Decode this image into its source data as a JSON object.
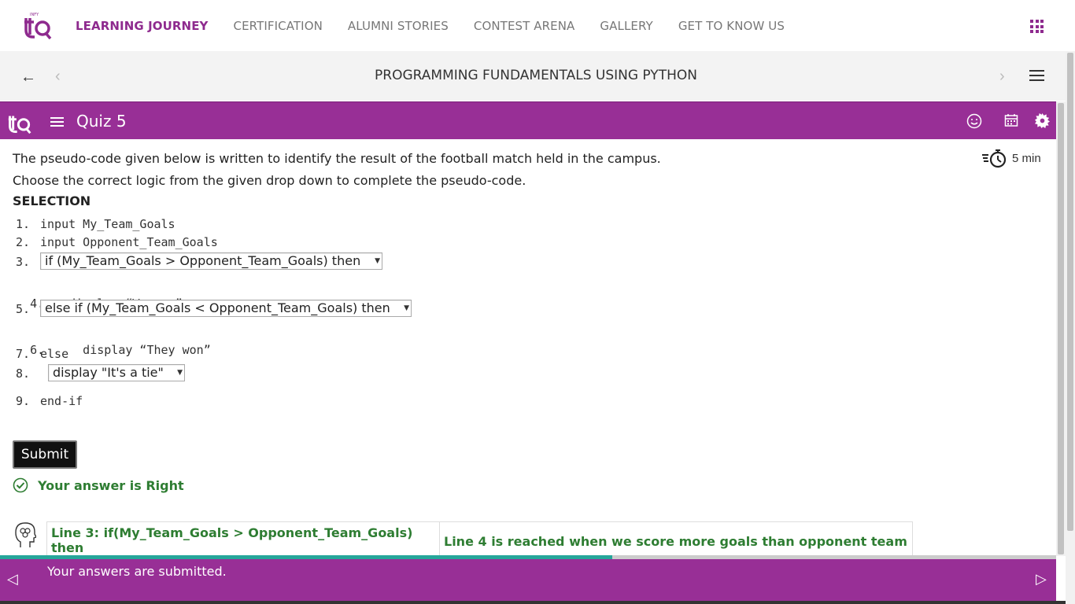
{
  "nav": {
    "items": [
      {
        "label": "LEARNING JOURNEY",
        "active": true
      },
      {
        "label": "CERTIFICATION",
        "active": false
      },
      {
        "label": "ALUMNI STORIES",
        "active": false
      },
      {
        "label": "CONTEST ARENA",
        "active": false
      },
      {
        "label": "GALLERY",
        "active": false
      },
      {
        "label": "GET TO KNOW US",
        "active": false
      }
    ],
    "apps_icon": "grid-apps-icon",
    "accent_color": "#8e2a8e"
  },
  "course": {
    "title": "PROGRAMMING FUNDAMENTALS USING PYTHON",
    "back_icon": "arrow-left-icon",
    "prev_icon": "chevron-left-icon",
    "next_icon": "chevron-right-icon",
    "menu_icon": "hamburger-icon"
  },
  "quiz": {
    "title": "Quiz 5",
    "header_color": "#982f96",
    "icons": [
      "smiley-icon",
      "calendar-icon",
      "gear-icon"
    ],
    "timer": "5 min"
  },
  "question": {
    "line1": "The pseudo-code given below is written to identify the result of the football match held in the campus.",
    "line2": "Choose the correct logic from the given drop down to complete the pseudo-code.",
    "heading": "SELECTION"
  },
  "code": {
    "lines": [
      {
        "num": "1.",
        "text": "input My_Team_Goals"
      },
      {
        "num": "2.",
        "text": "input Opponent_Team_Goals"
      },
      {
        "num": "3.",
        "select": "if (My_Team_Goals > Opponent_Team_Goals) then"
      },
      {
        "num": "4.",
        "text": "  display “We won”"
      },
      {
        "num": "5.",
        "select": "else if (My_Team_Goals < Opponent_Team_Goals) then"
      },
      {
        "num": "6.",
        "text": "    display “They won”"
      },
      {
        "num": "7.",
        "text": "else"
      },
      {
        "num": "8.",
        "select": "display \"It's a tie\""
      },
      {
        "num": "9.",
        "text": "end-if"
      }
    ]
  },
  "actions": {
    "submit_label": "Submit",
    "result_text": "Your answer is Right",
    "result_color": "#2e7d32"
  },
  "explanation": {
    "col1": "Line 3: if(My_Team_Goals > Opponent_Team_Goals) then",
    "col2": "Line 4 is reached when we score more goals than opponent team"
  },
  "footer": {
    "message": "Your answers are submitted.",
    "progress": 0.58
  }
}
